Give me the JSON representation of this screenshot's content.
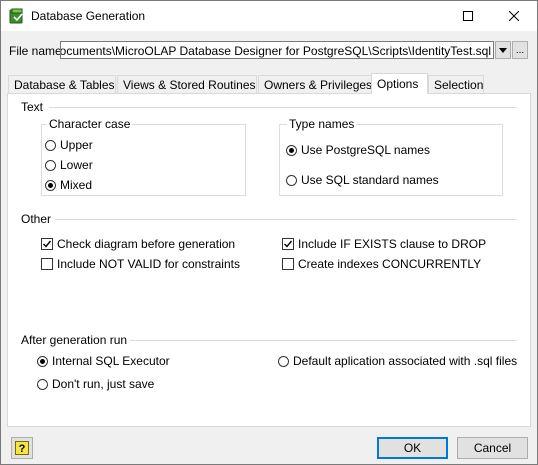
{
  "window": {
    "title": "Database Generation"
  },
  "file": {
    "label": "File name",
    "value": "el\\Documents\\MicroOLAP Database Designer for PostgreSQL\\Scripts\\IdentityTest.sql",
    "browse_label": "..."
  },
  "tabs": [
    {
      "label": "Database & Tables",
      "active": false
    },
    {
      "label": "Views & Stored Routines",
      "active": false
    },
    {
      "label": "Owners & Privileges",
      "active": false
    },
    {
      "label": "Options",
      "active": true
    },
    {
      "label": "Selection",
      "active": false
    }
  ],
  "text_section": {
    "title": "Text",
    "character_case": {
      "title": "Character case",
      "options": [
        {
          "label": "Upper",
          "selected": false
        },
        {
          "label": "Lower",
          "selected": false
        },
        {
          "label": "Mixed",
          "selected": true
        }
      ]
    },
    "type_names": {
      "title": "Type names",
      "options": [
        {
          "label": "Use PostgreSQL names",
          "selected": true
        },
        {
          "label": "Use SQL standard names",
          "selected": false
        }
      ]
    }
  },
  "other_section": {
    "title": "Other",
    "checks": [
      {
        "label": "Check diagram before generation",
        "checked": true
      },
      {
        "label": "Include NOT VALID for constraints",
        "checked": false
      },
      {
        "label": "Include IF EXISTS clause to DROP",
        "checked": true
      },
      {
        "label": "Create indexes CONCURRENTLY",
        "checked": false
      }
    ]
  },
  "after_section": {
    "title": "After generation run",
    "options": [
      {
        "label": "Internal SQL Executor",
        "selected": true
      },
      {
        "label": "Don't run, just save",
        "selected": false
      },
      {
        "label": "Default aplication associated with .sql files",
        "selected": false
      }
    ]
  },
  "footer": {
    "help_icon": "question-mark-icon",
    "ok_label": "OK",
    "cancel_label": "Cancel"
  },
  "colors": {
    "accent": "#0078d7",
    "help_icon_bg": "#f5e642"
  }
}
